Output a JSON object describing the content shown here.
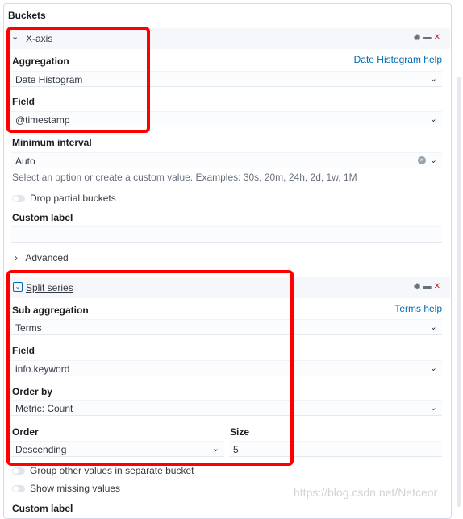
{
  "section_title": "Buckets",
  "xaxis": {
    "name": "X-axis",
    "aggregation_label": "Aggregation",
    "help_link": "Date Histogram help",
    "aggregation_value": "Date Histogram",
    "field_label": "Field",
    "field_value": "@timestamp",
    "interval_label": "Minimum interval",
    "interval_value": "Auto",
    "interval_hint": "Select an option or create a custom value. Examples: 30s, 20m, 24h, 2d, 1w, 1M",
    "drop_partial": "Drop partial buckets",
    "custom_label": "Custom label",
    "custom_label_value": "",
    "advanced": "Advanced"
  },
  "split": {
    "name": "Split series",
    "sub_agg_label": "Sub aggregation",
    "help_link": "Terms help",
    "sub_agg_value": "Terms",
    "field_label": "Field",
    "field_value": "info.keyword",
    "order_by_label": "Order by",
    "order_by_value": "Metric: Count",
    "order_label": "Order",
    "order_value": "Descending",
    "size_label": "Size",
    "size_value": "5",
    "group_other": "Group other values in separate bucket",
    "show_missing": "Show missing values",
    "custom_label": "Custom label"
  },
  "icons": {
    "visibility": "eye-icon",
    "drag": "drag-handle-icon",
    "remove": "close-icon",
    "collapse": "chevron-down-icon",
    "expand": "chevron-right-icon"
  },
  "colors": {
    "link": "#006bb4",
    "remove": "#bd271e",
    "highlight_box": "#ff0000"
  },
  "watermark": "https://blog.csdn.net/Netceor"
}
